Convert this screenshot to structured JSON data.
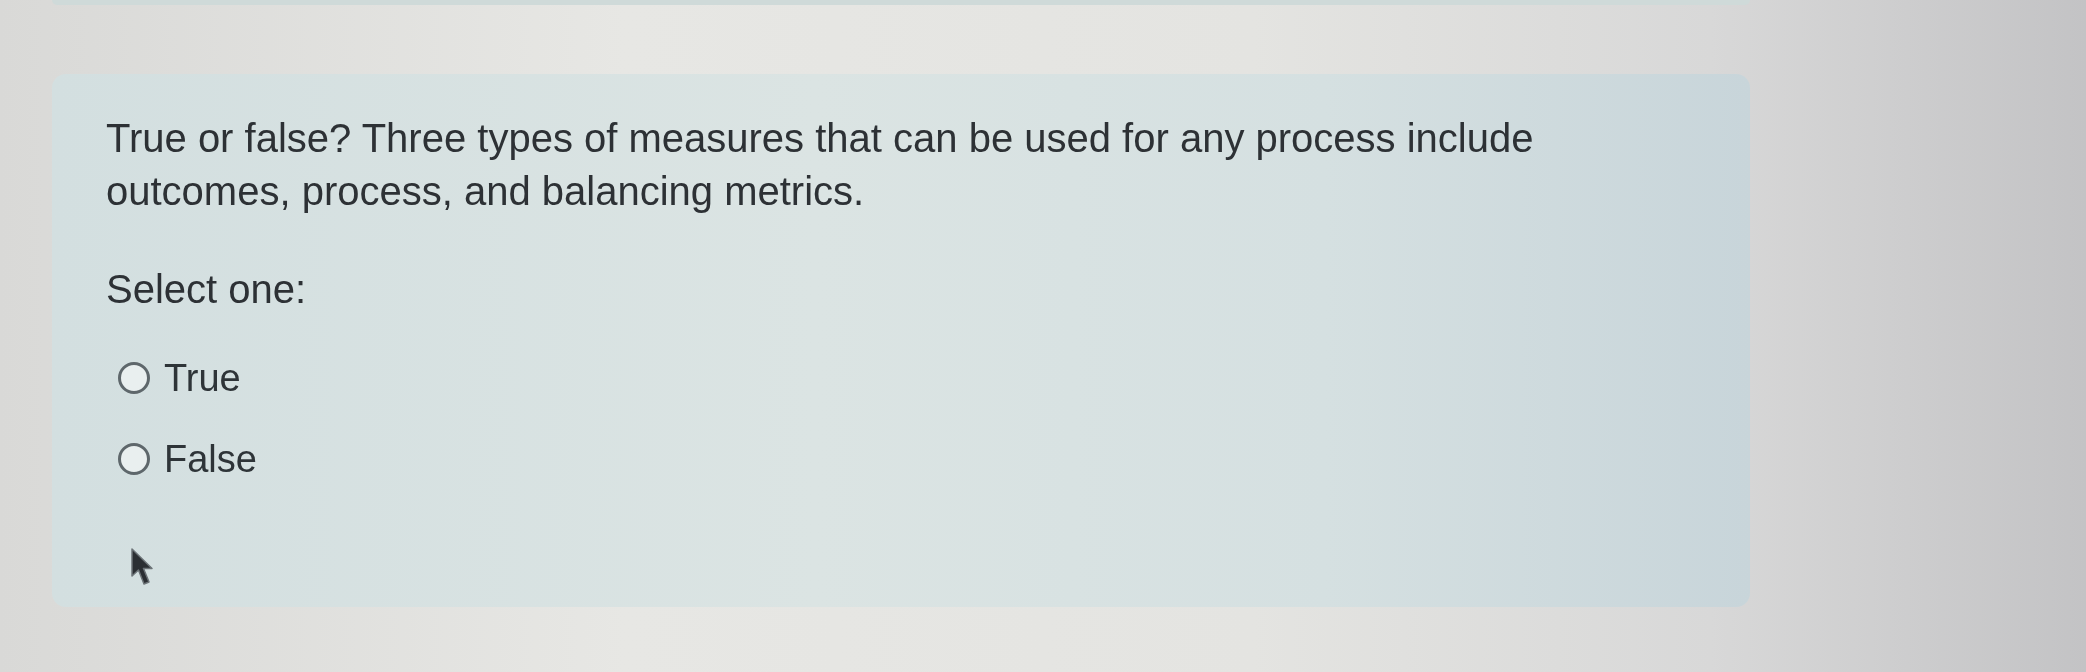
{
  "question": {
    "text": "True or false? Three types of measures that can be used for any process include outcomes, process, and balancing metrics.",
    "prompt": "Select one:",
    "options": [
      {
        "label": "True",
        "selected": false
      },
      {
        "label": "False",
        "selected": false
      }
    ]
  }
}
